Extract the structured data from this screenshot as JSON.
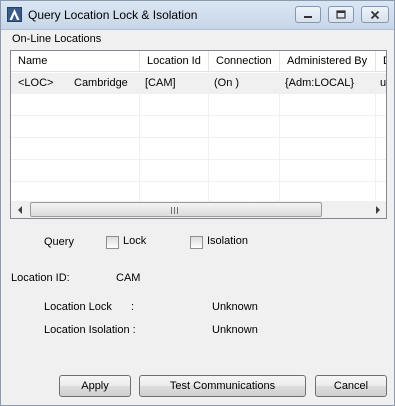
{
  "window": {
    "title": "Query Location Lock & Isolation"
  },
  "online_locations": {
    "group_label": "On-Line Locations",
    "columns": [
      "Name",
      "Location Id",
      "Connection",
      "Administered By",
      "D"
    ],
    "rows": [
      {
        "name_tag": "<LOC>",
        "name": "Cambridge",
        "location_id": "[CAM]",
        "connection": "(On )",
        "administered_by": "{Adm:LOCAL}",
        "d": "u"
      }
    ],
    "scroll_grip": "III"
  },
  "query": {
    "label": "Query",
    "lock_label": "Lock",
    "lock_checked": false,
    "isolation_label": "Isolation",
    "isolation_checked": false
  },
  "details": {
    "location_id_label": "Location ID:",
    "location_id_value": "CAM",
    "location_lock_label": "Location Lock",
    "location_lock_colon": ":",
    "location_lock_value": "Unknown",
    "location_isolation_label": "Location Isolation :",
    "location_isolation_value": "Unknown"
  },
  "buttons": {
    "apply": "Apply",
    "test_communications": "Test Communications",
    "cancel": "Cancel"
  },
  "icons": {
    "app": "app-logo-icon",
    "minimize": "minimize-icon",
    "maximize": "maximize-icon",
    "close": "close-icon",
    "scroll_left": "scroll-left-icon",
    "scroll_right": "scroll-right-icon"
  }
}
